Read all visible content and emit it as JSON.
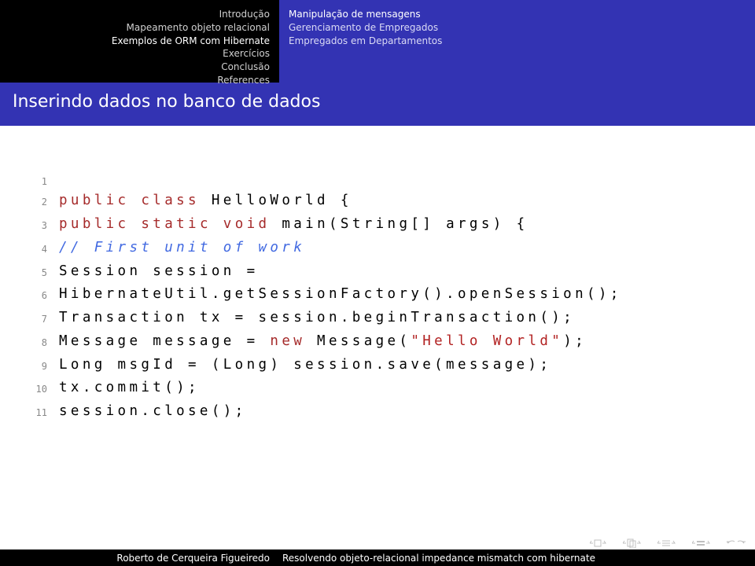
{
  "nav_left": {
    "items": [
      "Introdução",
      "Mapeamento objeto relacional",
      "Exemplos de ORM com Hibernate",
      "Exercícios",
      "Conclusão",
      "References"
    ],
    "active_index": 2
  },
  "nav_right": {
    "items": [
      "Manipulação de mensagens",
      "Gerenciamento de Empregados",
      "Empregados em Departamentos"
    ],
    "active_index": 0
  },
  "title": "Inserindo dados no banco de dados",
  "code": {
    "lines": [
      {
        "n": "1",
        "tokens": []
      },
      {
        "n": "2",
        "tokens": [
          {
            "t": "public",
            "c": "kw"
          },
          {
            "t": " "
          },
          {
            "t": "class",
            "c": "kw"
          },
          {
            "t": " HelloWorld {"
          }
        ]
      },
      {
        "n": "3",
        "tokens": [
          {
            "t": "public",
            "c": "kw"
          },
          {
            "t": " "
          },
          {
            "t": "static",
            "c": "kw"
          },
          {
            "t": " "
          },
          {
            "t": "void",
            "c": "kw"
          },
          {
            "t": " main(String[] args) {"
          }
        ]
      },
      {
        "n": "4",
        "tokens": [
          {
            "t": "// First unit of work",
            "c": "cmt"
          }
        ]
      },
      {
        "n": "5",
        "tokens": [
          {
            "t": "Session session ="
          }
        ]
      },
      {
        "n": "6",
        "tokens": [
          {
            "t": "HibernateUtil.getSessionFactory().openSession();"
          }
        ]
      },
      {
        "n": "7",
        "tokens": [
          {
            "t": "Transaction tx = session.beginTransaction();"
          }
        ]
      },
      {
        "n": "8",
        "tokens": [
          {
            "t": "Message message = "
          },
          {
            "t": "new",
            "c": "kw"
          },
          {
            "t": " Message("
          },
          {
            "t": "\"Hello World\"",
            "c": "str"
          },
          {
            "t": ");"
          }
        ]
      },
      {
        "n": "9",
        "tokens": [
          {
            "t": "Long msgId = (Long) session.save(message);"
          }
        ]
      },
      {
        "n": "10",
        "tokens": [
          {
            "t": "tx.commit();"
          }
        ]
      },
      {
        "n": "11",
        "tokens": [
          {
            "t": "session.close();"
          }
        ]
      }
    ]
  },
  "footer": {
    "author": "Roberto de Cerqueira Figueiredo",
    "subject": "Resolvendo objeto-relacional impedance mismatch com hibernate"
  }
}
